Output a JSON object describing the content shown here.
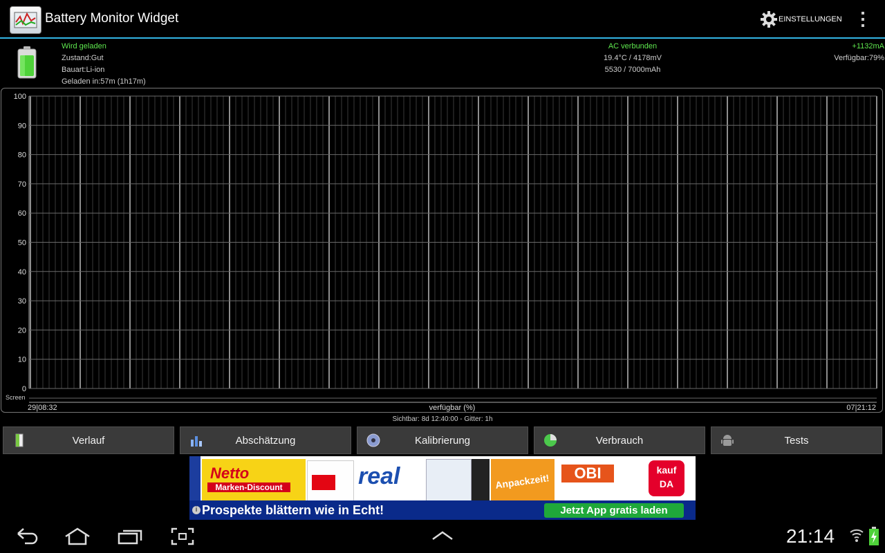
{
  "app": {
    "title": "Battery Monitor Widget",
    "settings_label": "EINSTELLUNGEN"
  },
  "status": {
    "charging": "Wird geladen",
    "condition": "Zustand:Gut",
    "type": "Bauart:Li-ion",
    "charged_in": "Geladen in:57m (1h17m)",
    "power_source": "AC verbunden",
    "temp_voltage": "19.4°C / 4178mV",
    "capacity": "5530 / 7000mAh",
    "current": "+1132mA",
    "available": "Verfügbar:79%"
  },
  "chart_data": {
    "type": "line",
    "y_ticks": [
      "100",
      "90",
      "80",
      "70",
      "60",
      "50",
      "40",
      "30",
      "20",
      "10",
      "0"
    ],
    "ylim": [
      0,
      100
    ],
    "x_start": "29|08:32",
    "x_end": "07|21:12",
    "xlabel": "verfügbar (%)",
    "screen_label": "Screen",
    "caption": "Sichtbar: 8d 12:40:00 - Gitter: 1h",
    "grid": true
  },
  "tabs": [
    {
      "label": "Verlauf",
      "icon": "door-icon"
    },
    {
      "label": "Abschätzung",
      "icon": "chart-icon"
    },
    {
      "label": "Kalibrierung",
      "icon": "disc-icon"
    },
    {
      "label": "Verbrauch",
      "icon": "pie-icon"
    },
    {
      "label": "Tests",
      "icon": "android-icon"
    }
  ],
  "ad": {
    "text": "Prospekte blättern wie in Echt!",
    "button": "Jetzt App gratis laden",
    "brands": [
      "Netto",
      "Marken-Discount",
      "real",
      "Anpackzeit!",
      "OBI",
      "kauf DA"
    ]
  },
  "system": {
    "clock": "21:14"
  },
  "colors": {
    "accent": "#33b5e5",
    "green": "#5fe84f",
    "tab_bg": "#3a3a3a"
  }
}
